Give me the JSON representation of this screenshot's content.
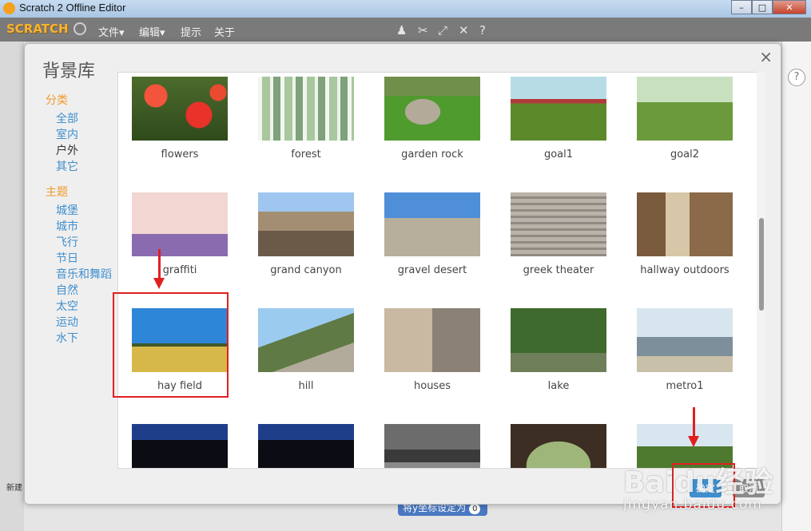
{
  "window": {
    "title": "Scratch 2 Offline Editor",
    "controls": [
      "–",
      "□",
      "✕"
    ]
  },
  "menubar": {
    "logo": "SCRATCH",
    "file": "文件▾",
    "edit": "编辑▾",
    "tips": "提示",
    "about": "关于"
  },
  "dialog": {
    "title": "背景库",
    "close": "×",
    "categories_heading": "分类",
    "categories": [
      "全部",
      "室内",
      "户外",
      "其它"
    ],
    "active_category": "户外",
    "themes_heading": "主题",
    "themes": [
      "城堡",
      "城市",
      "飞行",
      "节日",
      "音乐和舞蹈",
      "自然",
      "太空",
      "运动",
      "水下"
    ],
    "ok_button": "确定",
    "cancel_button": "取消",
    "backdrops": [
      {
        "name": "flowers"
      },
      {
        "name": "forest"
      },
      {
        "name": "garden rock"
      },
      {
        "name": "goal1"
      },
      {
        "name": "goal2"
      },
      {
        "name": "graffiti"
      },
      {
        "name": "grand canyon"
      },
      {
        "name": "gravel desert"
      },
      {
        "name": "greek theater"
      },
      {
        "name": "hallway outdoors"
      },
      {
        "name": "hay field"
      },
      {
        "name": "hill"
      },
      {
        "name": "houses"
      },
      {
        "name": "lake"
      },
      {
        "name": "metro1"
      },
      {
        "name": ""
      },
      {
        "name": ""
      },
      {
        "name": ""
      },
      {
        "name": ""
      },
      {
        "name": ""
      }
    ],
    "selected_backdrop": "hay field"
  },
  "background_app": {
    "coord_button": "将y坐标设定为",
    "coord_value": "0",
    "new_sprite": "新建",
    "help": "?"
  },
  "watermark": {
    "brand": "Baidu经验",
    "url": "jingyan.baidu.com"
  },
  "colors": {
    "accent_orange": "#f29a2a",
    "link_blue": "#3f8fce",
    "annotation_red": "#e02020"
  }
}
